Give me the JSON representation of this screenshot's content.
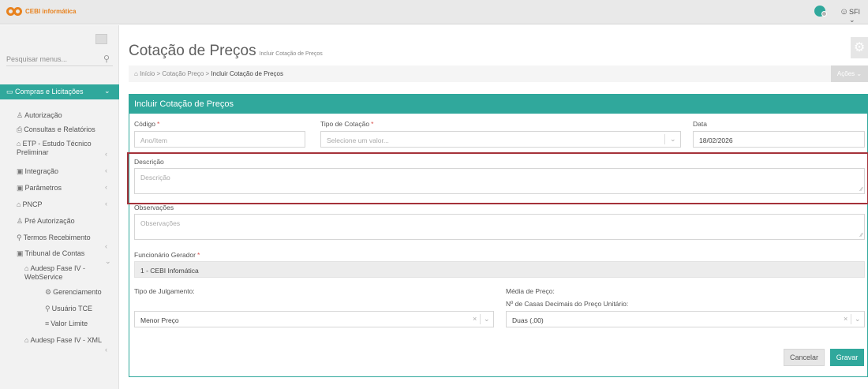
{
  "topbar": {
    "logo_text": "CEBI informática",
    "user": "SFI ⌄",
    "colors": {
      "accent": "#30a89c",
      "brand": "#e8821e",
      "highlight": "#a5323a"
    }
  },
  "sidebar": {
    "search_placeholder": "Pesquisar menus...",
    "active_menu": "Compras e Licitações",
    "items": [
      {
        "icon": "user-icon",
        "label": "Autorização"
      },
      {
        "icon": "print-icon",
        "label": "Consultas e Relatórios"
      },
      {
        "icon": "home-icon",
        "label": "ETP - Estudo Técnico",
        "label2": "Preliminar"
      },
      {
        "icon": "calendar-icon",
        "label": "Integração"
      },
      {
        "icon": "calendar-icon",
        "label": "Parâmetros"
      },
      {
        "icon": "home-icon",
        "label": "PNCP"
      },
      {
        "icon": "user-icon",
        "label": "Pré Autorização"
      },
      {
        "icon": "search-icon",
        "label": "Termos Recebimento"
      },
      {
        "icon": "calendar-icon",
        "label": "Tribunal de Contas"
      },
      {
        "icon": "home-icon",
        "label": "Audesp Fase IV -",
        "label2": "WebService"
      },
      {
        "icon": "gear-icon",
        "label": "Gerenciamento"
      },
      {
        "icon": "search-icon",
        "label": "Usuário TCE"
      },
      {
        "icon": "list-icon",
        "label": "Valor Limite"
      },
      {
        "icon": "home-icon",
        "label": "Audesp Fase IV - XML"
      }
    ]
  },
  "page": {
    "title": "Cotação de Preços",
    "subtitle": "Incluir Cotação de Preços",
    "breadcrumb": {
      "home": "Início",
      "sep": ">",
      "level1": "Cotação Preço",
      "current": "Incluir Cotação de Preços"
    },
    "actions_label": "Ações ⌄"
  },
  "form": {
    "panel_title": "Incluir Cotação de Preços",
    "required_mark": "*",
    "codigo": {
      "label": "Código",
      "placeholder": "Ano/Item"
    },
    "tipo_cotacao": {
      "label": "Tipo de Cotação",
      "placeholder": "Selecione um valor..."
    },
    "data": {
      "label": "Data",
      "value": "18/02/2026"
    },
    "descricao": {
      "label": "Descrição",
      "placeholder": "Descrição"
    },
    "observacoes": {
      "label": "Observações",
      "placeholder": "Observações"
    },
    "funcionario": {
      "label": "Funcionário Gerador",
      "value": "1 - CEBI Infomática"
    },
    "tipo_julgamento": {
      "label": "Tipo de Julgamento:",
      "value": "Menor Preço"
    },
    "media_preco": {
      "label": "Média de Preço:"
    },
    "casas_decimais": {
      "label": "Nº de Casas Decimais do Preço Unitário:",
      "value": "Duas (,00)"
    },
    "cancel_label": "Cancelar",
    "save_label": "Gravar"
  }
}
